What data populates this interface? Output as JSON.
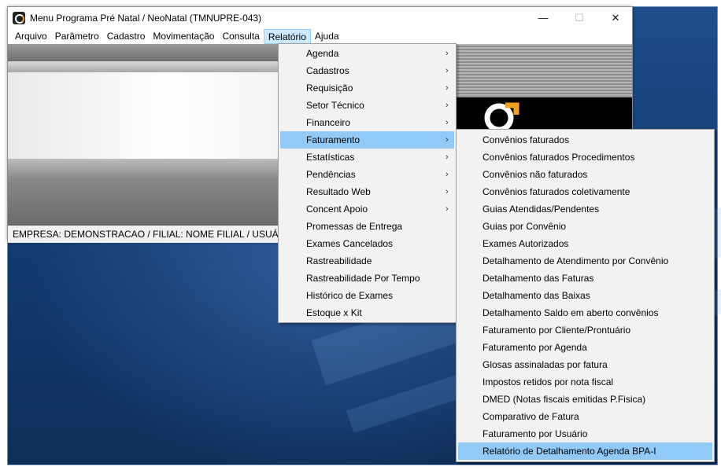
{
  "window": {
    "title": "Menu Programa Pré Natal / NeoNatal (TMNUPRE-043)",
    "minimize": "—",
    "maximize": "☐",
    "close": "✕"
  },
  "menubar": [
    {
      "label": "Arquivo"
    },
    {
      "label": "Parâmetro"
    },
    {
      "label": "Cadastro"
    },
    {
      "label": "Movimentação"
    },
    {
      "label": "Consulta"
    },
    {
      "label": "Relatório"
    },
    {
      "label": "Ajuda"
    }
  ],
  "status_line": "EMPRESA: DEMONSTRACAO / FILIAL: NOME FILIAL / USUÁRIO",
  "relatorio_menu": [
    {
      "label": "Agenda",
      "submenu": true
    },
    {
      "label": "Cadastros",
      "submenu": true
    },
    {
      "label": "Requisição",
      "submenu": true
    },
    {
      "label": "Setor Técnico",
      "submenu": true
    },
    {
      "label": "Financeiro",
      "submenu": true
    },
    {
      "label": "Faturamento",
      "submenu": true
    },
    {
      "label": "Estatísticas",
      "submenu": true
    },
    {
      "label": "Pendências",
      "submenu": true
    },
    {
      "label": "Resultado Web",
      "submenu": true
    },
    {
      "label": "Concent Apoio",
      "submenu": true
    },
    {
      "label": "Promessas de Entrega",
      "submenu": false
    },
    {
      "label": "Exames Cancelados",
      "submenu": false
    },
    {
      "label": "Rastreabilidade",
      "submenu": false
    },
    {
      "label": "Rastreabilidade Por Tempo",
      "submenu": false
    },
    {
      "label": "Histórico de Exames",
      "submenu": false
    },
    {
      "label": "Estoque x Kit",
      "submenu": false
    }
  ],
  "faturamento_menu": [
    {
      "label": "Convênios faturados"
    },
    {
      "label": "Convênios faturados Procedimentos"
    },
    {
      "label": "Convênios não faturados"
    },
    {
      "label": "Convênios faturados coletivamente"
    },
    {
      "label": "Guias Atendidas/Pendentes"
    },
    {
      "label": "Guias por Convênio"
    },
    {
      "label": "Exames Autorizados"
    },
    {
      "label": "Detalhamento de Atendimento por Convênio"
    },
    {
      "label": "Detalhamento das Faturas"
    },
    {
      "label": "Detalhamento das Baixas"
    },
    {
      "label": "Detalhamento Saldo em aberto convênios"
    },
    {
      "label": "Faturamento por Cliente/Prontuário"
    },
    {
      "label": "Faturamento por Agenda"
    },
    {
      "label": "Glosas assinaladas por fatura"
    },
    {
      "label": "Impostos retidos por nota fiscal"
    },
    {
      "label": "DMED (Notas fiscais emitidas P.Fisica)"
    },
    {
      "label": "Comparativo de Fatura"
    },
    {
      "label": "Faturamento por Usuário"
    },
    {
      "label": "Relatório de Detalhamento Agenda BPA-I"
    }
  ],
  "highlight": {
    "relatorio_item": "Faturamento",
    "faturamento_item": "Relatório de Detalhamento Agenda BPA-I",
    "color": "#91c9f7"
  },
  "colors": {
    "desktop": "#1a447f",
    "menu_bg": "#f2f2f2",
    "menubar_active": "#cce8ff"
  }
}
